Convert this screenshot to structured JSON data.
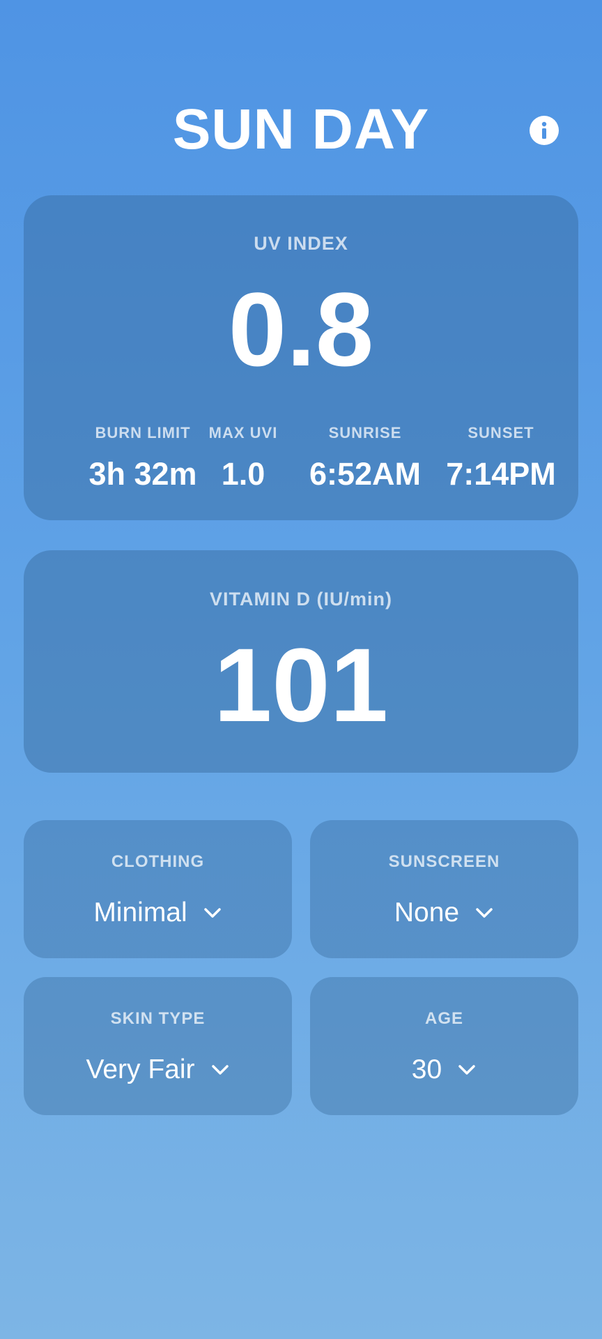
{
  "header": {
    "title": "SUN DAY",
    "info_icon": "info-icon"
  },
  "uv_card": {
    "label": "UV INDEX",
    "value": "0.8",
    "stats": [
      {
        "label": "BURN LIMIT",
        "value": "3h 32m"
      },
      {
        "label": "MAX UVI",
        "value": "1.0"
      },
      {
        "label": "SUNRISE",
        "value": "6:52AM"
      },
      {
        "label": "SUNSET",
        "value": "7:14PM"
      }
    ]
  },
  "vitamin_d_card": {
    "label": "VITAMIN D (IU/min)",
    "value": "101"
  },
  "settings": {
    "clothing": {
      "label": "CLOTHING",
      "value": "Minimal"
    },
    "sunscreen": {
      "label": "SUNSCREEN",
      "value": "None"
    },
    "skin_type": {
      "label": "SKIN TYPE",
      "value": "Very Fair"
    },
    "age": {
      "label": "AGE",
      "value": "30"
    }
  },
  "colors": {
    "background_top": "#4f94e4",
    "background_bottom": "#7db5e5",
    "text": "#ffffff"
  }
}
